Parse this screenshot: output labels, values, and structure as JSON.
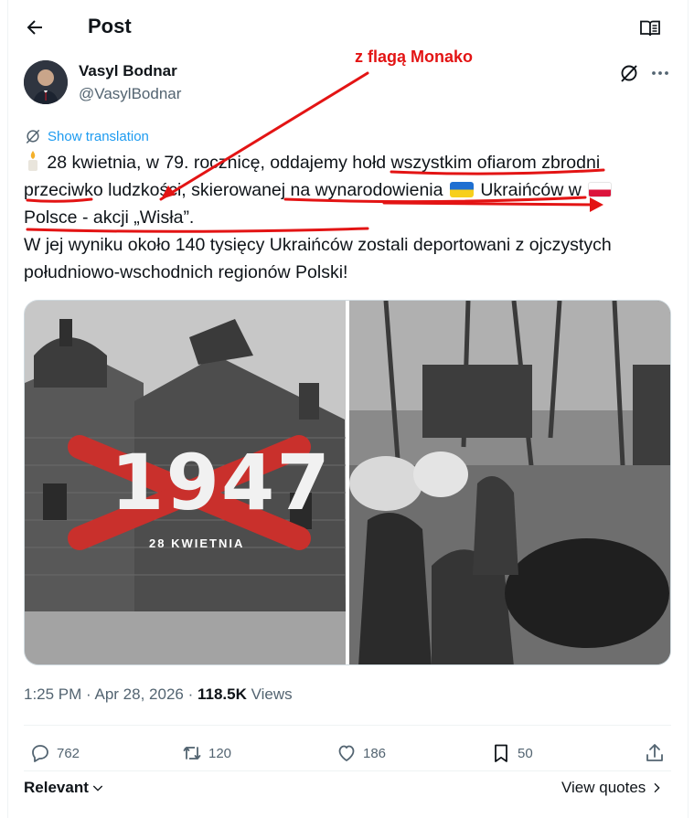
{
  "header": {
    "title": "Post",
    "back_icon": "arrow-left-icon",
    "reader_icon": "open-book-icon"
  },
  "author": {
    "name": "Vasyl Bodnar",
    "handle": "@VasylBodnar"
  },
  "translation": {
    "label": "Show translation"
  },
  "post": {
    "text_1": "28 kwietnia, w 79. rocznicę, oddajemy hołd wszystkim ofiarom zbrodni przeciwko ludzkości, skierowanej na wynarodowienia",
    "text_2": "Ukraińców w",
    "text_3": "Polsce - akcji „Wisła”.",
    "text_4": "W jej wyniku około 140 tysięcy Ukraińców zostali deportowani z ojczystych południowo-wschodnich regionów Polski!"
  },
  "annotation": {
    "label": "z flagą Monako",
    "color": "#e31414"
  },
  "media": {
    "image_1_year": "1947",
    "image_1_caption": "28 KWIETNIA"
  },
  "meta": {
    "time": "1:25 PM",
    "date": "Apr 28, 2026",
    "views_count": "118.5K",
    "views_label": "Views"
  },
  "actions": {
    "replies": "762",
    "reposts": "120",
    "likes": "186",
    "bookmarks": "50"
  },
  "footer": {
    "sort_label": "Relevant",
    "view_quotes_label": "View quotes"
  },
  "colors": {
    "accent": "#1d9bf0",
    "text_primary": "#0f1419",
    "text_secondary": "#536471",
    "annotation_red": "#e31414",
    "flag_ukraine_blue": "#1f6fd1",
    "flag_ukraine_yellow": "#f7cf1b"
  }
}
